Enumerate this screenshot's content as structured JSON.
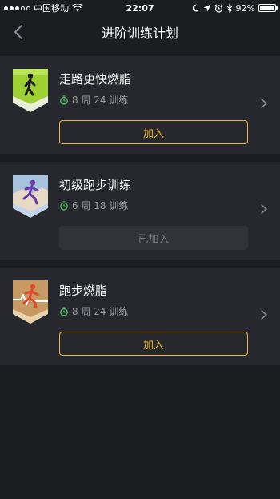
{
  "status_bar": {
    "carrier": "中国移动",
    "time": "22:07",
    "battery": "92%",
    "battery_level": 0.92
  },
  "nav": {
    "title": "进阶训练计划",
    "back_icon": "chevron-left-icon"
  },
  "plans": [
    {
      "title": "走路更快燃脂",
      "meta": "8 周 24 训练",
      "button_label": "加入",
      "button_state": "join",
      "badge_icon": "walking-figure-badge",
      "badge_color": "#9ed132"
    },
    {
      "title": "初级跑步训练",
      "meta": "6 周 18 训练",
      "button_label": "已加入",
      "button_state": "joined",
      "badge_icon": "running-figure-badge",
      "badge_color": "#a8c2dd"
    },
    {
      "title": "跑步燃脂",
      "meta": "8 周 24 训练",
      "button_label": "加入",
      "button_state": "join",
      "badge_icon": "running-heartbeat-badge",
      "badge_color": "#c79a63"
    }
  ],
  "colors": {
    "accent": "#f2b630",
    "timer_icon": "#4cc163",
    "card_bg": "#27282d",
    "page_bg": "#1c1d21"
  }
}
